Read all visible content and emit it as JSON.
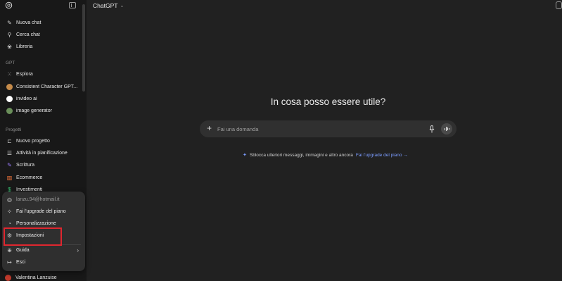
{
  "header": {
    "model_label": "ChatGPT",
    "model_chevron": "⌄"
  },
  "sidebar": {
    "nav": [
      {
        "label": "Nuova chat",
        "icon": "new-chat-icon",
        "glyph": "✎"
      },
      {
        "label": "Cerca chat",
        "icon": "search-icon",
        "glyph": "⚲"
      },
      {
        "label": "Libreria",
        "icon": "library-icon",
        "glyph": "❀"
      }
    ],
    "gpt_heading": "GPT",
    "gpts": [
      {
        "label": "Esplora",
        "icon": "explore-icon",
        "glyph": "⁙"
      },
      {
        "label": "Consistent Character GPT...",
        "icon": "gpt-avatar-icon",
        "color": "#c58b4a"
      },
      {
        "label": "invideo ai",
        "icon": "gpt-avatar-icon",
        "color": "#ffffff"
      },
      {
        "label": "image generator",
        "icon": "gpt-avatar-icon",
        "color": "#6a8f5a"
      }
    ],
    "projects_heading": "Progetti",
    "projects": [
      {
        "label": "Nuovo progetto",
        "icon": "new-folder-icon",
        "glyph": "⊏",
        "color": "#d0d0d0"
      },
      {
        "label": "Attività in pianificazione",
        "icon": "tasks-icon",
        "glyph": "☰",
        "color": "#d0d0d0"
      },
      {
        "label": "Scrittura",
        "icon": "pen-icon",
        "glyph": "✎",
        "color": "#9b7cff"
      },
      {
        "label": "Ecommerce",
        "icon": "chart-icon",
        "glyph": "▥",
        "color": "#ff7a3d"
      },
      {
        "label": "Investimenti",
        "icon": "dollar-icon",
        "glyph": "$",
        "color": "#3ad07a"
      }
    ],
    "user_name": "Valentina Lanzuise"
  },
  "popup": {
    "email": "lanzu.94@hotmail.it",
    "items": [
      {
        "label": "Fai l'upgrade del piano",
        "icon": "sparkle-icon",
        "glyph": "✧"
      },
      {
        "label": "Personalizzazione",
        "icon": "personalize-icon",
        "glyph": "◔"
      },
      {
        "label": "Impostazioni",
        "icon": "settings-gear-icon",
        "glyph": "⚙"
      }
    ],
    "guide": {
      "label": "Guida",
      "icon": "help-icon",
      "glyph": "⊕",
      "chevron": "›"
    },
    "logout": {
      "label": "Esci",
      "icon": "logout-icon",
      "glyph": "↦"
    }
  },
  "main": {
    "headline": "In cosa posso essere utile?",
    "composer": {
      "placeholder": "Fai una domanda",
      "value": ""
    },
    "upsell": {
      "text": "Sblocca ulteriori messaggi, immagini e altro ancora",
      "link": "Fai l'upgrade del piano →"
    }
  },
  "colors": {
    "accent_link": "#7b9cff",
    "highlight": "#e0262f",
    "background": "#212121",
    "sidebar": "#181818"
  }
}
